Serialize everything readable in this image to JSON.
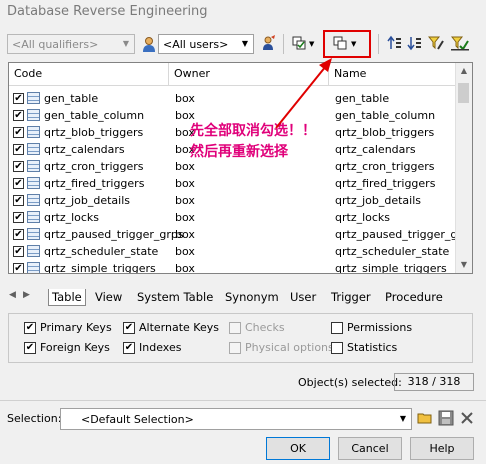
{
  "window": {
    "title": "Database Reverse Engineering"
  },
  "toolbar": {
    "qualifiers": "<All qualifiers>",
    "users": "<All users>"
  },
  "columns": [
    "Code",
    "Owner",
    "Name"
  ],
  "rows": [
    {
      "code": "gen_table",
      "owner": "box",
      "name": "gen_table"
    },
    {
      "code": "gen_table_column",
      "owner": "box",
      "name": "gen_table_column"
    },
    {
      "code": "qrtz_blob_triggers",
      "owner": "box",
      "name": "qrtz_blob_triggers"
    },
    {
      "code": "qrtz_calendars",
      "owner": "box",
      "name": "qrtz_calendars"
    },
    {
      "code": "qrtz_cron_triggers",
      "owner": "box",
      "name": "qrtz_cron_triggers"
    },
    {
      "code": "qrtz_fired_triggers",
      "owner": "box",
      "name": "qrtz_fired_triggers"
    },
    {
      "code": "qrtz_job_details",
      "owner": "box",
      "name": "qrtz_job_details"
    },
    {
      "code": "qrtz_locks",
      "owner": "box",
      "name": "qrtz_locks"
    },
    {
      "code": "qrtz_paused_trigger_grps",
      "owner": "box",
      "name": "qrtz_paused_trigger_grps"
    },
    {
      "code": "qrtz_scheduler_state",
      "owner": "box",
      "name": "qrtz_scheduler_state"
    },
    {
      "code": "qrtz_simple_triggers",
      "owner": "box",
      "name": "qrtz_simple_triggers"
    }
  ],
  "tabs": [
    "Table",
    "View",
    "System Table",
    "Synonym",
    "User",
    "Trigger",
    "Procedure"
  ],
  "options": {
    "primary_keys": "Primary Keys",
    "foreign_keys": "Foreign Keys",
    "alternate_keys": "Alternate Keys",
    "indexes": "Indexes",
    "checks": "Checks",
    "physical_options": "Physical options",
    "permissions": "Permissions",
    "statistics": "Statistics"
  },
  "status": {
    "label": "Object(s) selected:",
    "value": "318 / 318"
  },
  "selection": {
    "label": "Selection:",
    "value": "<Default Selection>"
  },
  "buttons": {
    "ok": "OK",
    "cancel": "Cancel",
    "help": "Help"
  },
  "annotation": {
    "line1": "先全部取消勾选！！",
    "line2": "然后再重新选择"
  },
  "colors": {
    "annotation": "#e0007a",
    "highlight_box": "#e00000"
  }
}
